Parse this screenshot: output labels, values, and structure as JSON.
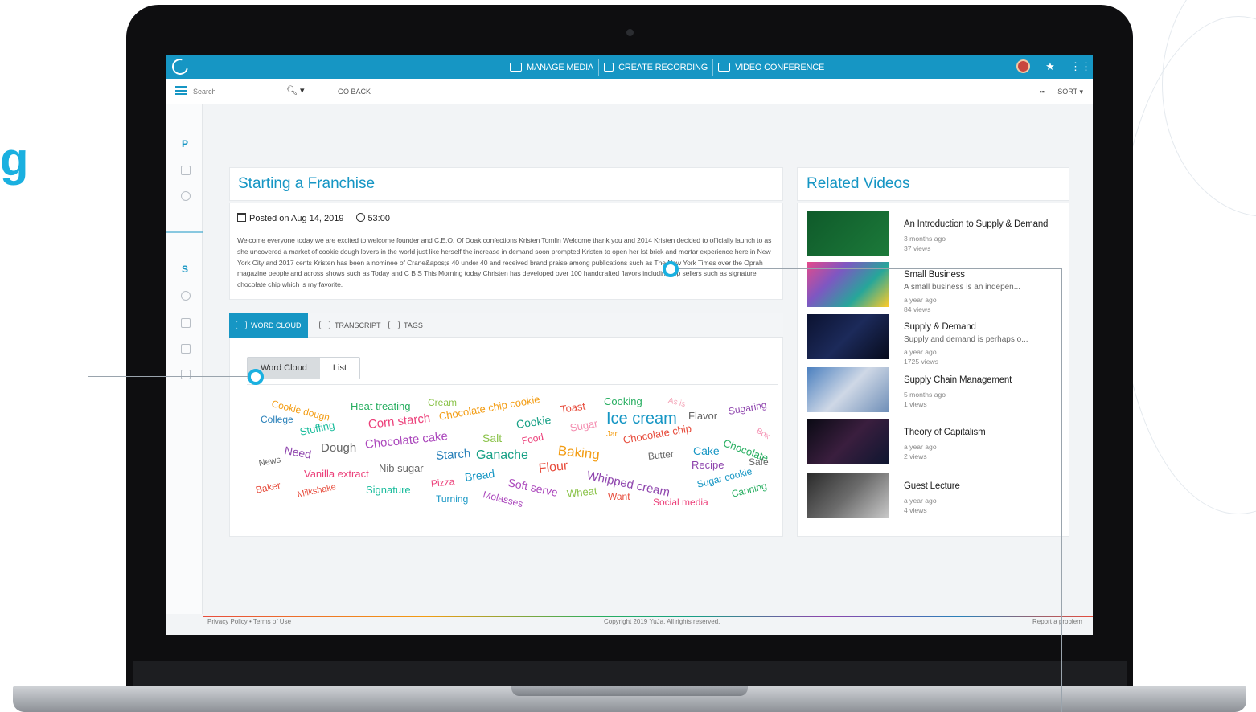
{
  "brand_fragment": "g",
  "app": {
    "nav": {
      "manage_media": "MANAGE MEDIA",
      "create_recording": "CREATE RECORDING",
      "video_conference": "VIDEO CONFERENCE"
    },
    "toolbar": {
      "search_placeholder": "Search",
      "go_back": "GO BACK",
      "sort": "SORT ▾"
    },
    "sidebar": {
      "section_p": "P",
      "section_s": "S"
    }
  },
  "video": {
    "title": "Starting a Franchise",
    "posted": "Posted on Aug 14, 2019",
    "duration": "53:00",
    "description": "Welcome everyone today we are excited to welcome founder and C.E.O. Of Doak confections Kristen Tomlin Welcome thank you and 2014 Kristen decided to officially launch to as she uncovered a market of cookie dough lovers in the world just like herself the increase in demand soon prompted Kristen to open her Ist brick and mortar experience here in New York City and 2017 cents Kristen has been a nominee of Crane&apos;s 40 under 40 and received brand praise among publications such as The New York Times over the Oprah magazine people and across shows such as Today and C B S This Morning today Christen has developed over 100 handcrafted flavors including top sellers such as signature chocolate chip which is my favorite."
  },
  "tabs": {
    "word_cloud": "WORD CLOUD",
    "transcript": "TRANSCRIPT",
    "tags": "TAGS"
  },
  "view_toggle": {
    "word_cloud": "Word Cloud",
    "list": "List"
  },
  "word_cloud": [
    {
      "text": "Cookie dough",
      "color": "#f39c12"
    },
    {
      "text": "College",
      "color": "#2980b9"
    },
    {
      "text": "Heat treating",
      "color": "#27ae60"
    },
    {
      "text": "Cream",
      "color": "#8bc34a"
    },
    {
      "text": "Chocolate chip cookie",
      "color": "#f39c12"
    },
    {
      "text": "Toast",
      "color": "#e74c3c"
    },
    {
      "text": "Cooking",
      "color": "#27ae60"
    },
    {
      "text": "As is",
      "color": "#f3a0b4"
    },
    {
      "text": "Sugaring",
      "color": "#8e44ad"
    },
    {
      "text": "Stuffing",
      "color": "#1abc9c"
    },
    {
      "text": "Corn starch",
      "color": "#ec407a"
    },
    {
      "text": "Cookie",
      "color": "#16a085"
    },
    {
      "text": "Sugar",
      "color": "#f48fb1"
    },
    {
      "text": "Ice cream",
      "color": "#1696c4"
    },
    {
      "text": "Flavor",
      "color": "#666666"
    },
    {
      "text": "Box",
      "color": "#f48fb1"
    },
    {
      "text": "Need",
      "color": "#8e44ad"
    },
    {
      "text": "Dough",
      "color": "#666666"
    },
    {
      "text": "Chocolate cake",
      "color": "#ab47bc"
    },
    {
      "text": "Salt",
      "color": "#8bc34a"
    },
    {
      "text": "Food",
      "color": "#ec407a"
    },
    {
      "text": "Jar",
      "color": "#f39c12"
    },
    {
      "text": "Chocolate chip",
      "color": "#e74c3c"
    },
    {
      "text": "Chocolate",
      "color": "#27ae60"
    },
    {
      "text": "News",
      "color": "#666666"
    },
    {
      "text": "Starch",
      "color": "#2980b9"
    },
    {
      "text": "Ganache",
      "color": "#16a085"
    },
    {
      "text": "Baking",
      "color": "#f39c12"
    },
    {
      "text": "Cake",
      "color": "#1696c4"
    },
    {
      "text": "Butter",
      "color": "#666666"
    },
    {
      "text": "Safe",
      "color": "#666666"
    },
    {
      "text": "Vanilla extract",
      "color": "#ec407a"
    },
    {
      "text": "Nib sugar",
      "color": "#666666"
    },
    {
      "text": "Flour",
      "color": "#e74c3c"
    },
    {
      "text": "Recipe",
      "color": "#8e44ad"
    },
    {
      "text": "Baker",
      "color": "#e74c3c"
    },
    {
      "text": "Pizza",
      "color": "#ec407a"
    },
    {
      "text": "Bread",
      "color": "#1696c4"
    },
    {
      "text": "Soft serve",
      "color": "#ab47bc"
    },
    {
      "text": "Whipped cream",
      "color": "#8e44ad"
    },
    {
      "text": "Sugar cookie",
      "color": "#1696c4"
    },
    {
      "text": "Milkshake",
      "color": "#e74c3c"
    },
    {
      "text": "Signature",
      "color": "#1abc9c"
    },
    {
      "text": "Turning",
      "color": "#1696c4"
    },
    {
      "text": "Molasses",
      "color": "#ab47bc"
    },
    {
      "text": "Wheat",
      "color": "#8bc34a"
    },
    {
      "text": "Want",
      "color": "#e74c3c"
    },
    {
      "text": "Social media",
      "color": "#ec407a"
    },
    {
      "text": "Canning",
      "color": "#27ae60"
    }
  ],
  "related": {
    "title": "Related Videos",
    "items": [
      {
        "name": "An Introduction to Supply & Demand",
        "desc": "",
        "age": "3 months ago",
        "views": "37 views"
      },
      {
        "name": "Small Business",
        "desc": "A small business is an indepen...",
        "age": "a year ago",
        "views": "84 views"
      },
      {
        "name": "Supply & Demand",
        "desc": "Supply and demand is perhaps o...",
        "age": "a year ago",
        "views": "1725 views"
      },
      {
        "name": "Supply Chain Management",
        "desc": "",
        "age": "5 months ago",
        "views": "1 views"
      },
      {
        "name": "Theory of Capitalism",
        "desc": "",
        "age": "a year ago",
        "views": "2 views"
      },
      {
        "name": "Guest Lecture",
        "desc": "",
        "age": "a year ago",
        "views": "4 views"
      }
    ]
  },
  "footer": {
    "policy": "Privacy Policy • Terms of Use",
    "copyright": "Copyright 2019 YuJa. All rights reserved.",
    "report": "Report a problem"
  },
  "colors": {
    "accent": "#1696c4",
    "callout": "#1ab0e0"
  }
}
